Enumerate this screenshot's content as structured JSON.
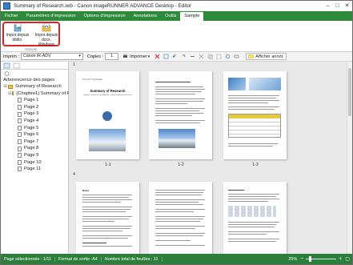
{
  "window": {
    "title": "Summary of Research.iwb - Canon imageRUNNER ADVANCE Desktop - Editor",
    "controls": [
      "minimize",
      "maximize",
      "close"
    ]
  },
  "ribbon": {
    "tabs": [
      "Fichier",
      "Paramètres d'impression",
      "Options d'impression",
      "Annotations",
      "Outils",
      "Sample"
    ],
    "active_tab": "Sample",
    "buttons": [
      {
        "label": "Impor.depuis\nbiblio.",
        "icon": "import-library-icon"
      },
      {
        "label": "Impor.depuis docs.\nWindows",
        "icon": "import-windows-docs-icon"
      }
    ],
    "group_label": "Sample"
  },
  "toolbar": {
    "printer_label": "Imprim :",
    "printer_value": "Canon iR-ADV",
    "copies_label": "Copies :",
    "copies_value": "1",
    "print_button": "Imprimer",
    "show_annot": "Afficher annot."
  },
  "left_panel": {
    "header": "Arborescence des pages",
    "tree": [
      {
        "label": "Summary of Research",
        "level": 0,
        "type": "root"
      },
      {
        "label": "(Chapitre1) Summary of R",
        "level": 1,
        "type": "folder"
      },
      {
        "label": "Page 1",
        "level": 2,
        "type": "page"
      },
      {
        "label": "Page 2",
        "level": 2,
        "type": "page"
      },
      {
        "label": "Page 3",
        "level": 2,
        "type": "page"
      },
      {
        "label": "Page 4",
        "level": 2,
        "type": "page"
      },
      {
        "label": "Page 5",
        "level": 2,
        "type": "page"
      },
      {
        "label": "Page 6",
        "level": 2,
        "type": "page"
      },
      {
        "label": "Page 7",
        "level": 2,
        "type": "page"
      },
      {
        "label": "Page 8",
        "level": 2,
        "type": "page"
      },
      {
        "label": "Page 9",
        "level": 2,
        "type": "page"
      },
      {
        "label": "Page 10",
        "level": 2,
        "type": "page"
      },
      {
        "label": "Page 11",
        "level": 2,
        "type": "page"
      }
    ]
  },
  "workspace": {
    "sections": [
      "1",
      "4"
    ],
    "page_labels": [
      "1-1",
      "1-2",
      "1-3"
    ],
    "page1": {
      "company": "The CCY Corporation",
      "title": "Summary of Research",
      "subtitle": "Regional Research Development / Oxford Inspiration Research"
    },
    "page4": {
      "heading": "Notes"
    }
  },
  "statusbar": {
    "selected": "Page sélectionnée : 1/11",
    "format": "Format de sortie :A4",
    "sheets": "Nombre total de feuilles : 11",
    "zoom": "25%"
  }
}
